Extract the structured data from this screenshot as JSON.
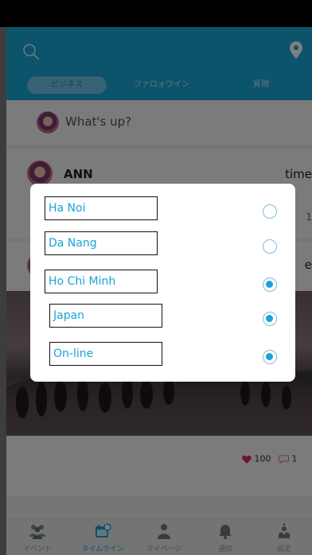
{
  "header": {
    "tabs": [
      {
        "label": "ビジネス",
        "active": true
      },
      {
        "label": "ファロォウイン",
        "active": false
      },
      {
        "label": "質問",
        "active": false
      }
    ]
  },
  "composer": {
    "prompt": "What's up?"
  },
  "posts": [
    {
      "author": "ANN",
      "time": "time",
      "trailing": "1"
    },
    {
      "trailing": "e",
      "likes": "100",
      "comments": "1"
    }
  ],
  "region_dialog": {
    "options": [
      {
        "label": "Ha Noi",
        "selected": false
      },
      {
        "label": "Da Nang",
        "selected": false
      },
      {
        "label": "Ho Chi Minh",
        "selected": true
      },
      {
        "label": "Japan",
        "selected": true
      },
      {
        "label": "On-line",
        "selected": true
      }
    ]
  },
  "bottom_nav": [
    {
      "label": "イベント",
      "icon": "people-icon",
      "active": false
    },
    {
      "label": "タイムライン",
      "icon": "calendar-icon",
      "active": true
    },
    {
      "label": "マイページ",
      "icon": "person-icon",
      "active": false
    },
    {
      "label": "通知",
      "icon": "bell-icon",
      "active": false
    },
    {
      "label": "設定",
      "icon": "settings-icon",
      "active": false
    }
  ],
  "colors": {
    "primary": "#18a6d9",
    "overlay": "#000000"
  }
}
